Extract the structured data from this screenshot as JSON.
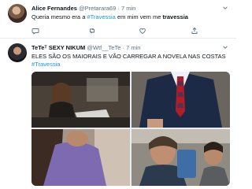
{
  "tweet1": {
    "name": "Alice Fernandes",
    "handle": "@Pretarara69",
    "separator": "·",
    "time": "7 min",
    "text_before": "Queria mesmo era a ",
    "hashtag": "#Travessia",
    "text_mid": " em mim vem me ",
    "text_bold": "travessia"
  },
  "tweet2": {
    "name": "TeTeᵀ SEXY NIKUM",
    "handle": "@Wtf__TeTe",
    "separator": "·",
    "time": "7 min",
    "text": "ELES SÃO OS MAIORAIS E VÃO CARREGAR A NOVELA NAS COSTAS",
    "hashtag": "#Travessia"
  },
  "icons": [
    "reply-icon",
    "retweet-icon",
    "like-icon",
    "share-icon",
    "chevron-down-icon"
  ],
  "colors": {
    "link": "#1b95e0",
    "secondary": "#5b7083",
    "divider": "#e6ecf0"
  }
}
